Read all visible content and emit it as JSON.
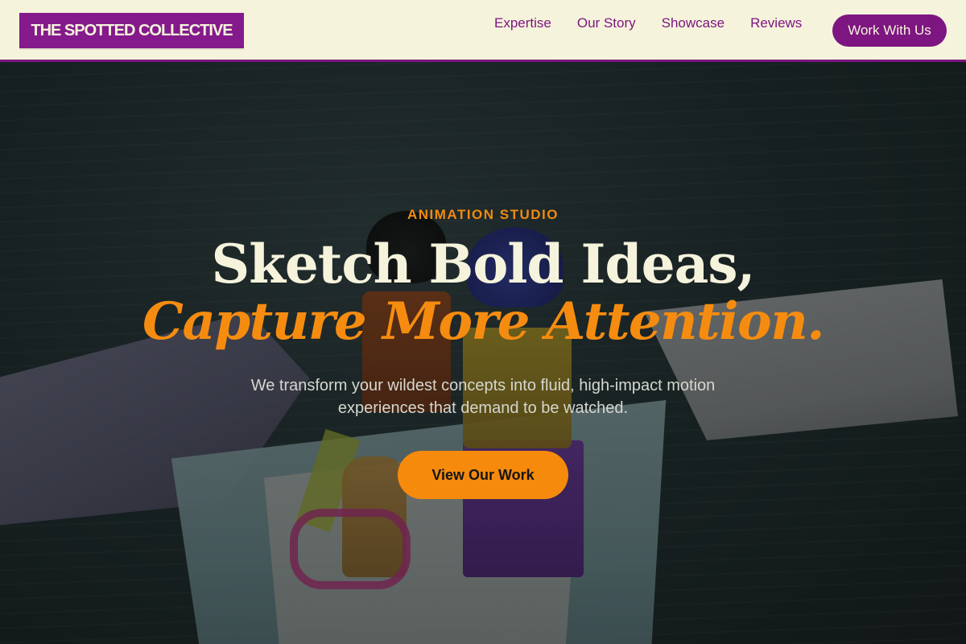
{
  "header": {
    "logo_text": "THE SPOTTED COLLECTIVE",
    "nav": [
      {
        "label": "Expertise"
      },
      {
        "label": "Our Story"
      },
      {
        "label": "Showcase"
      },
      {
        "label": "Reviews"
      }
    ],
    "cta_label": "Work With Us"
  },
  "hero": {
    "eyebrow": "ANIMATION STUDIO",
    "headline_line1": "Sketch Bold Ideas,",
    "headline_line2": "Capture More Attention.",
    "subtext": "We transform your wildest concepts into fluid, high-impact motion experiences that demand to be watched.",
    "button_label": "View Our Work"
  },
  "colors": {
    "brand_purple": "#7d1680",
    "header_bg": "#f5f3dc",
    "accent_orange": "#f58a0c",
    "headline_cream": "#f5f3dc"
  }
}
